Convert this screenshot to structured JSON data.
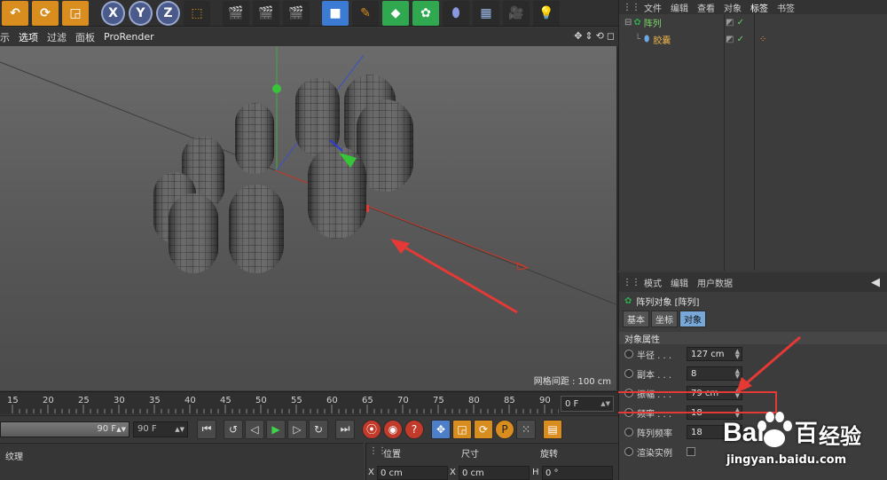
{
  "toolbar": {
    "axis_x": "X",
    "axis_y": "Y",
    "axis_z": "Z"
  },
  "viewport": {
    "menu": {
      "display_partial": "示",
      "options": "选项",
      "filter": "过滤",
      "panel": "面板",
      "prorender": "ProRender"
    },
    "grid_spacing_label": "网格间距 : 100 cm"
  },
  "object_manager": {
    "menu": {
      "file": "文件",
      "edit": "编辑",
      "view": "查看",
      "object": "对象",
      "tags": "标签",
      "bookmarks": "书签"
    },
    "objects": [
      {
        "name": "阵列"
      },
      {
        "name": "胶囊"
      }
    ]
  },
  "attribute_manager": {
    "menu": {
      "mode": "模式",
      "edit": "编辑",
      "user_data": "用户数据"
    },
    "title": "阵列对象 [阵列]",
    "tabs": [
      "基本",
      "坐标",
      "对象"
    ],
    "section_title": "对象属性",
    "properties": [
      {
        "label": "半径 . . .",
        "value": "127 cm"
      },
      {
        "label": "副本 . . .",
        "value": "8"
      },
      {
        "label": "振幅 . . .",
        "value": "79 cm"
      },
      {
        "label": "频率 . . .",
        "value": "18"
      },
      {
        "label": "阵列频率",
        "value": "18"
      },
      {
        "label": "渲染实例",
        "value": ""
      }
    ]
  },
  "timeline": {
    "ticks": [
      "15",
      "20",
      "25",
      "30",
      "35",
      "40",
      "45",
      "50",
      "55",
      "60",
      "65",
      "70",
      "75",
      "80",
      "85",
      "90"
    ],
    "current_frame": "0 F"
  },
  "playback": {
    "end_frame_slider": "90 F",
    "end_frame_field": "90 F"
  },
  "bottom": {
    "material_label": "纹理",
    "coords": {
      "position": "位置",
      "size": "尺寸",
      "rotation": "旋转",
      "x_label": "X",
      "x_position": "0 cm",
      "x_size": "0 cm",
      "h_label": "H",
      "h_rotation": "0 °"
    }
  },
  "watermark": {
    "brand": "Bai",
    "brand_end": "百",
    "jingyan": "经验",
    "url": "jingyan.baidu.com"
  },
  "colors": {
    "accent_orange": "#d98d1e",
    "highlight_red": "#e53935",
    "active_tab_blue": "#78a8d8",
    "object_green": "#7cd66a"
  }
}
